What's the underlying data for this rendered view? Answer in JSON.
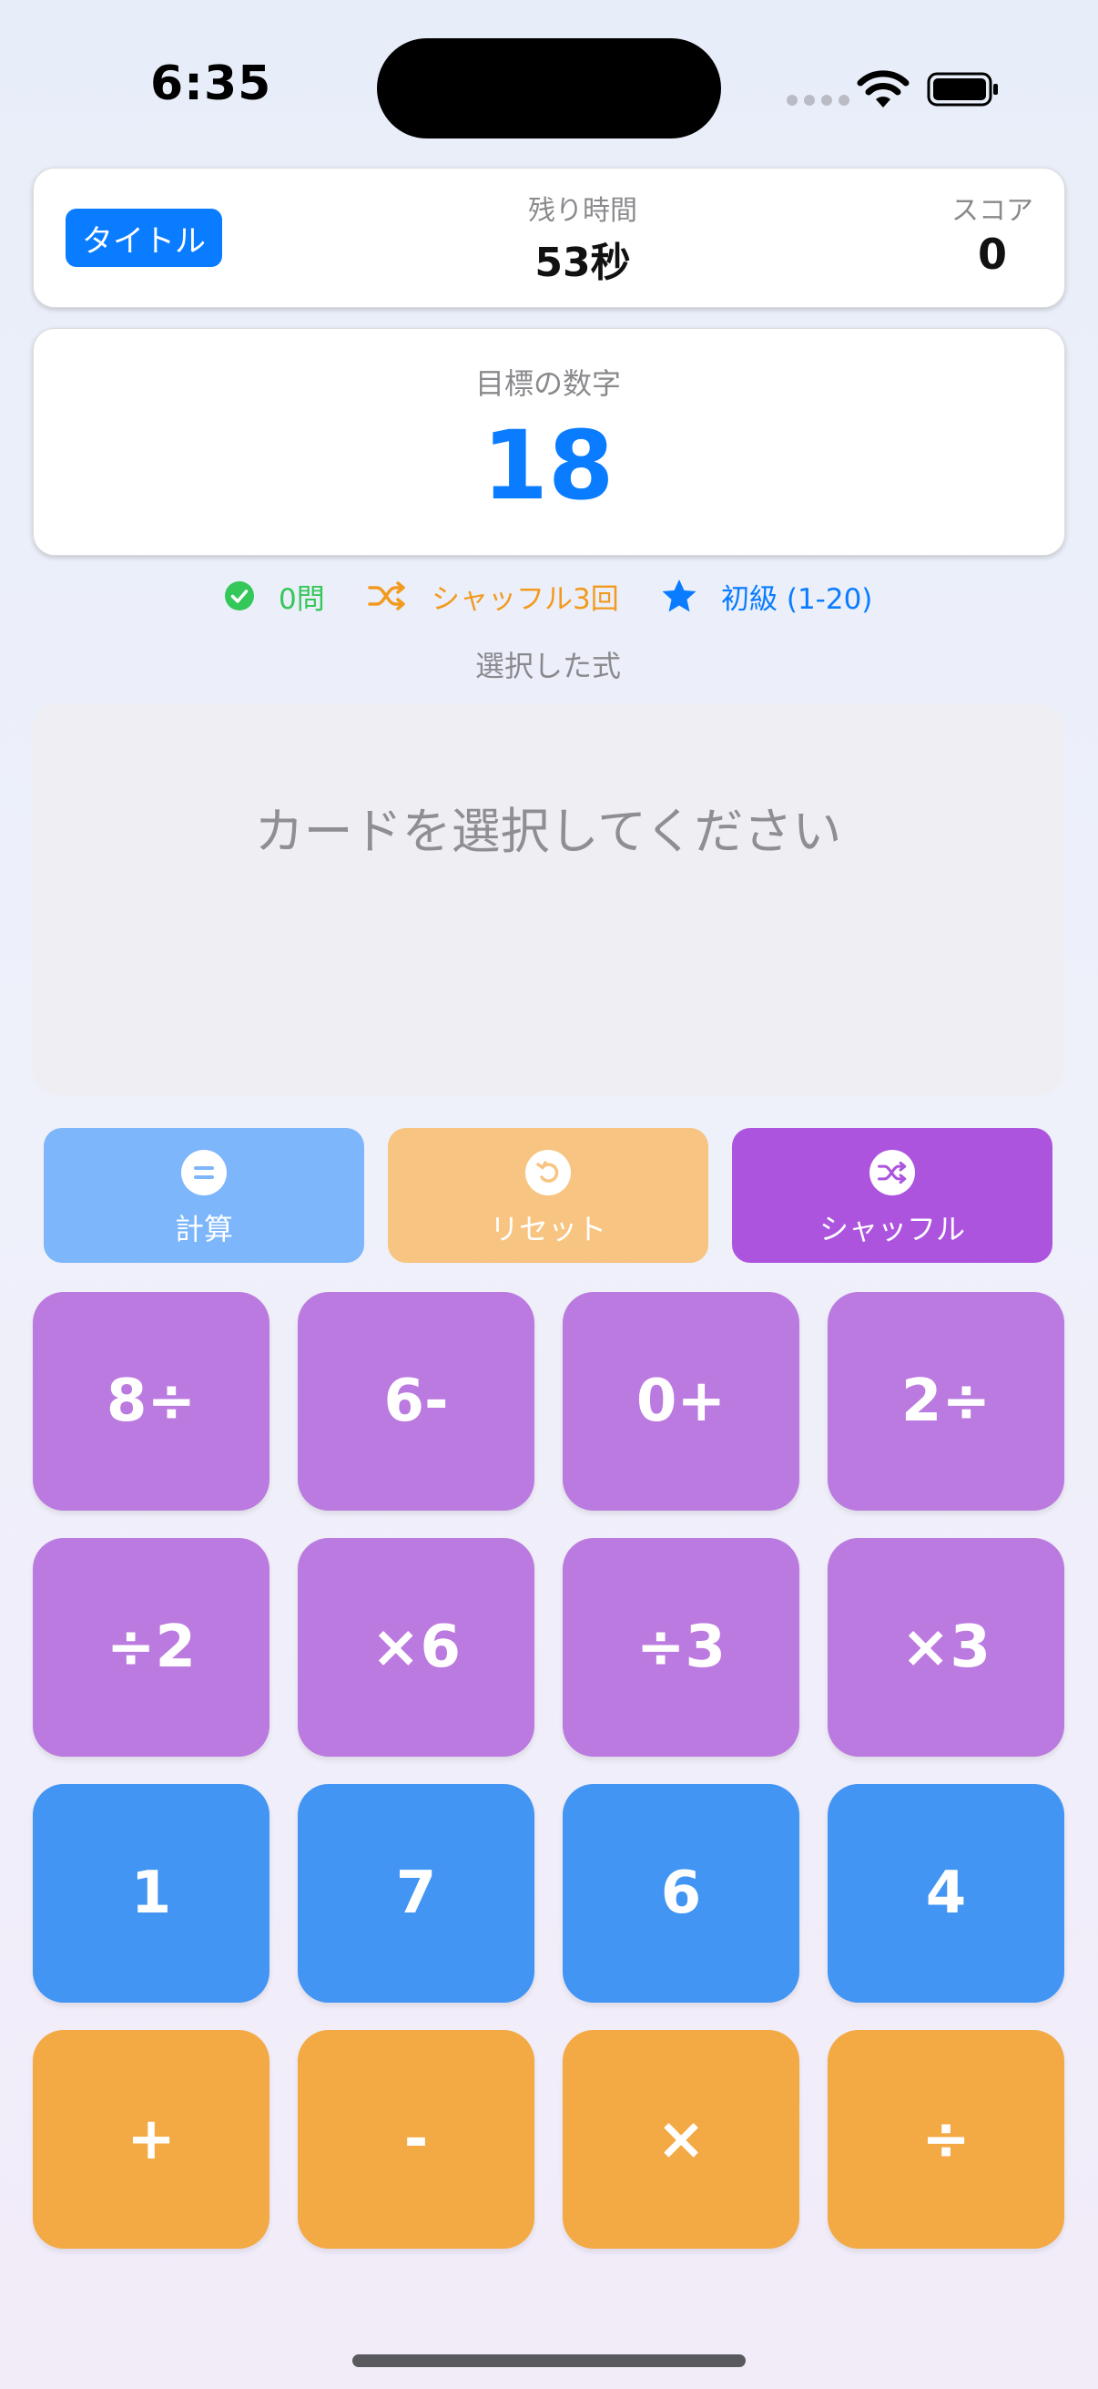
{
  "status": {
    "time": "6:35"
  },
  "header": {
    "title_button": "タイトル",
    "time_label": "残り時間",
    "time_value": "53秒",
    "score_label": "スコア",
    "score_value": "0"
  },
  "target": {
    "label": "目標の数字",
    "value": "18"
  },
  "info": {
    "solved": "0問",
    "shuffle": "シャッフル3回",
    "level": "初級 (1-20)"
  },
  "formula": {
    "label": "選択した式",
    "placeholder": "カードを選択してください"
  },
  "actions": {
    "calculate": "計算",
    "reset": "リセット",
    "shuffle": "シャッフル"
  },
  "cards": {
    "row1": [
      "8÷",
      "6-",
      "0+",
      "2÷"
    ],
    "row2": [
      "÷2",
      "×6",
      "÷3",
      "×3"
    ],
    "row3": [
      "1",
      "7",
      "6",
      "4"
    ],
    "row4": [
      "+",
      "-",
      "×",
      "÷"
    ]
  },
  "colors": {
    "accent": "#0a7cff",
    "green": "#34c759",
    "orange": "#f29a1f",
    "purple_card": "#bb7adf",
    "blue_card": "#4295f3",
    "orange_card": "#f3a944",
    "calc_button": "#7db6fb",
    "reset_button": "#f8c482",
    "shuffle_button": "#ad54de"
  },
  "icons": {
    "solved": "checkmark-circle-icon",
    "shuffle": "shuffle-icon",
    "level": "star-icon",
    "calculate": "equal-circle-icon",
    "reset": "undo-circle-icon",
    "shuffle_action": "shuffle-circle-icon"
  }
}
